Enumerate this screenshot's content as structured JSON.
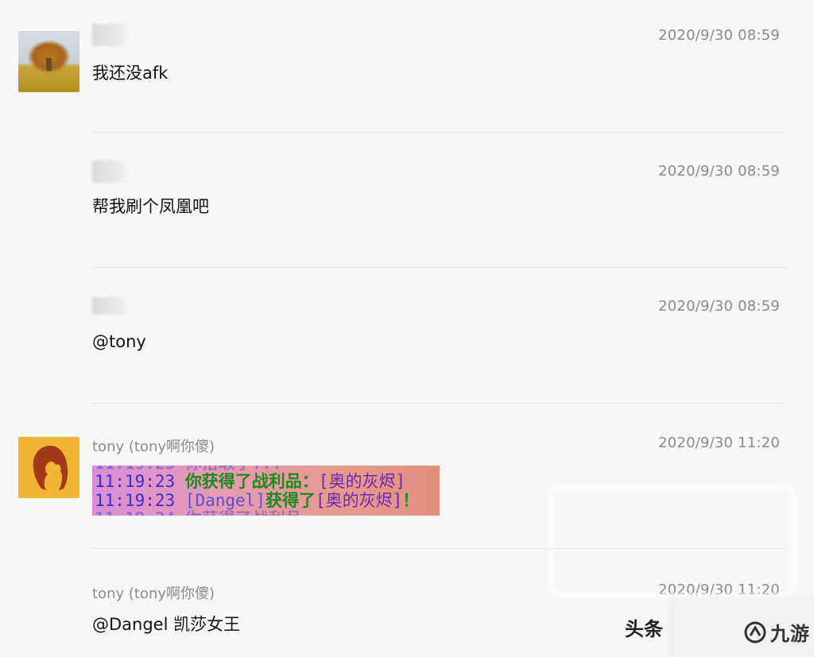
{
  "messages": [
    {
      "sender": "",
      "time": "2020/9/30 08:59",
      "text": "我还没afk"
    },
    {
      "sender": "",
      "time": "2020/9/30 08:59",
      "text": "帮我刷个凤凰吧"
    },
    {
      "sender": "",
      "time": "2020/9/30 08:59",
      "text": "@tony"
    },
    {
      "sender": "tony (tony啊你傻)",
      "time": "2020/9/30 11:20",
      "text": "",
      "image_lines": [
        {
          "ts": "11:19:23",
          "body": "你获得了战利品：",
          "item": "[奥的灰烬]"
        },
        {
          "ts": "11:19:23",
          "player": "[Dangel]",
          "body": "获得了",
          "item": "[奥的灰烬]",
          "tail": "！"
        }
      ]
    },
    {
      "sender": "tony (tony啊你傻)",
      "time": "2020/9/30 11:20",
      "text": "@Dangel 凯莎女王"
    }
  ],
  "watermark": {
    "text": "头条",
    "logo": "九游"
  },
  "icons": [
    "tree-avatar-icon",
    "lion-avatar-icon",
    "jiuyou-logo-icon"
  ]
}
